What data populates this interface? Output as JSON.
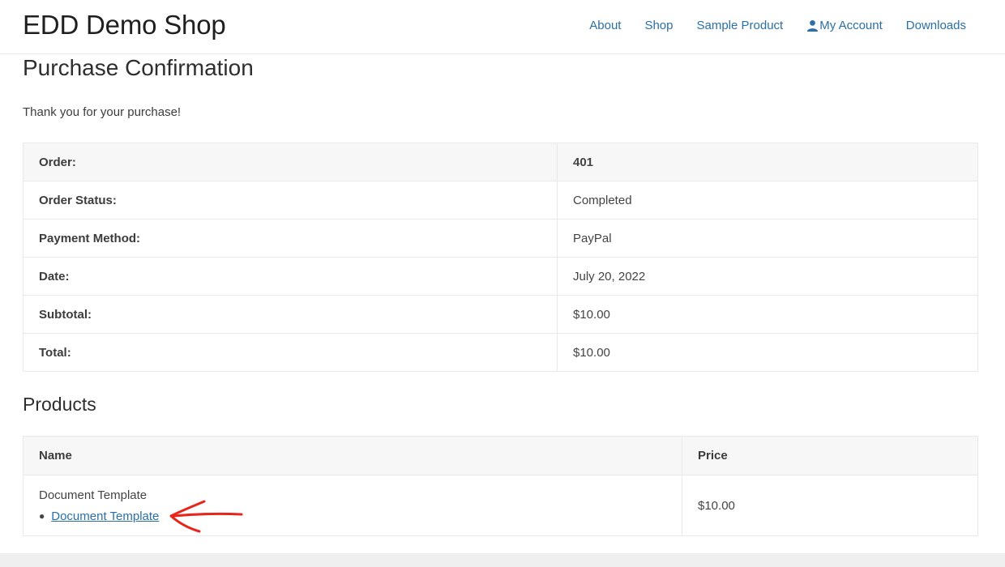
{
  "site": {
    "title": "EDD Demo Shop"
  },
  "nav": {
    "items": [
      {
        "label": "About"
      },
      {
        "label": "Shop"
      },
      {
        "label": "Sample Product"
      },
      {
        "label": "My Account"
      },
      {
        "label": "Downloads"
      }
    ]
  },
  "page": {
    "title": "Purchase Confirmation",
    "thanks": "Thank you for your purchase!"
  },
  "receipt": {
    "rows": [
      {
        "label": "Order:",
        "value": "401"
      },
      {
        "label": "Order Status:",
        "value": "Completed"
      },
      {
        "label": "Payment Method:",
        "value": "PayPal"
      },
      {
        "label": "Date:",
        "value": "July 20, 2022"
      },
      {
        "label": "Subtotal:",
        "value": "$10.00"
      },
      {
        "label": "Total:",
        "value": "$10.00"
      }
    ]
  },
  "products": {
    "title": "Products",
    "headers": {
      "name": "Name",
      "price": "Price"
    },
    "items": [
      {
        "name": "Document Template",
        "file_link": "Document Template",
        "price": "$10.00"
      }
    ]
  },
  "icons": {
    "account": "user-icon",
    "annotation": "red-arrow-annotation"
  },
  "colors": {
    "link": "#2a6fa8",
    "annotation": "#e8251b"
  }
}
